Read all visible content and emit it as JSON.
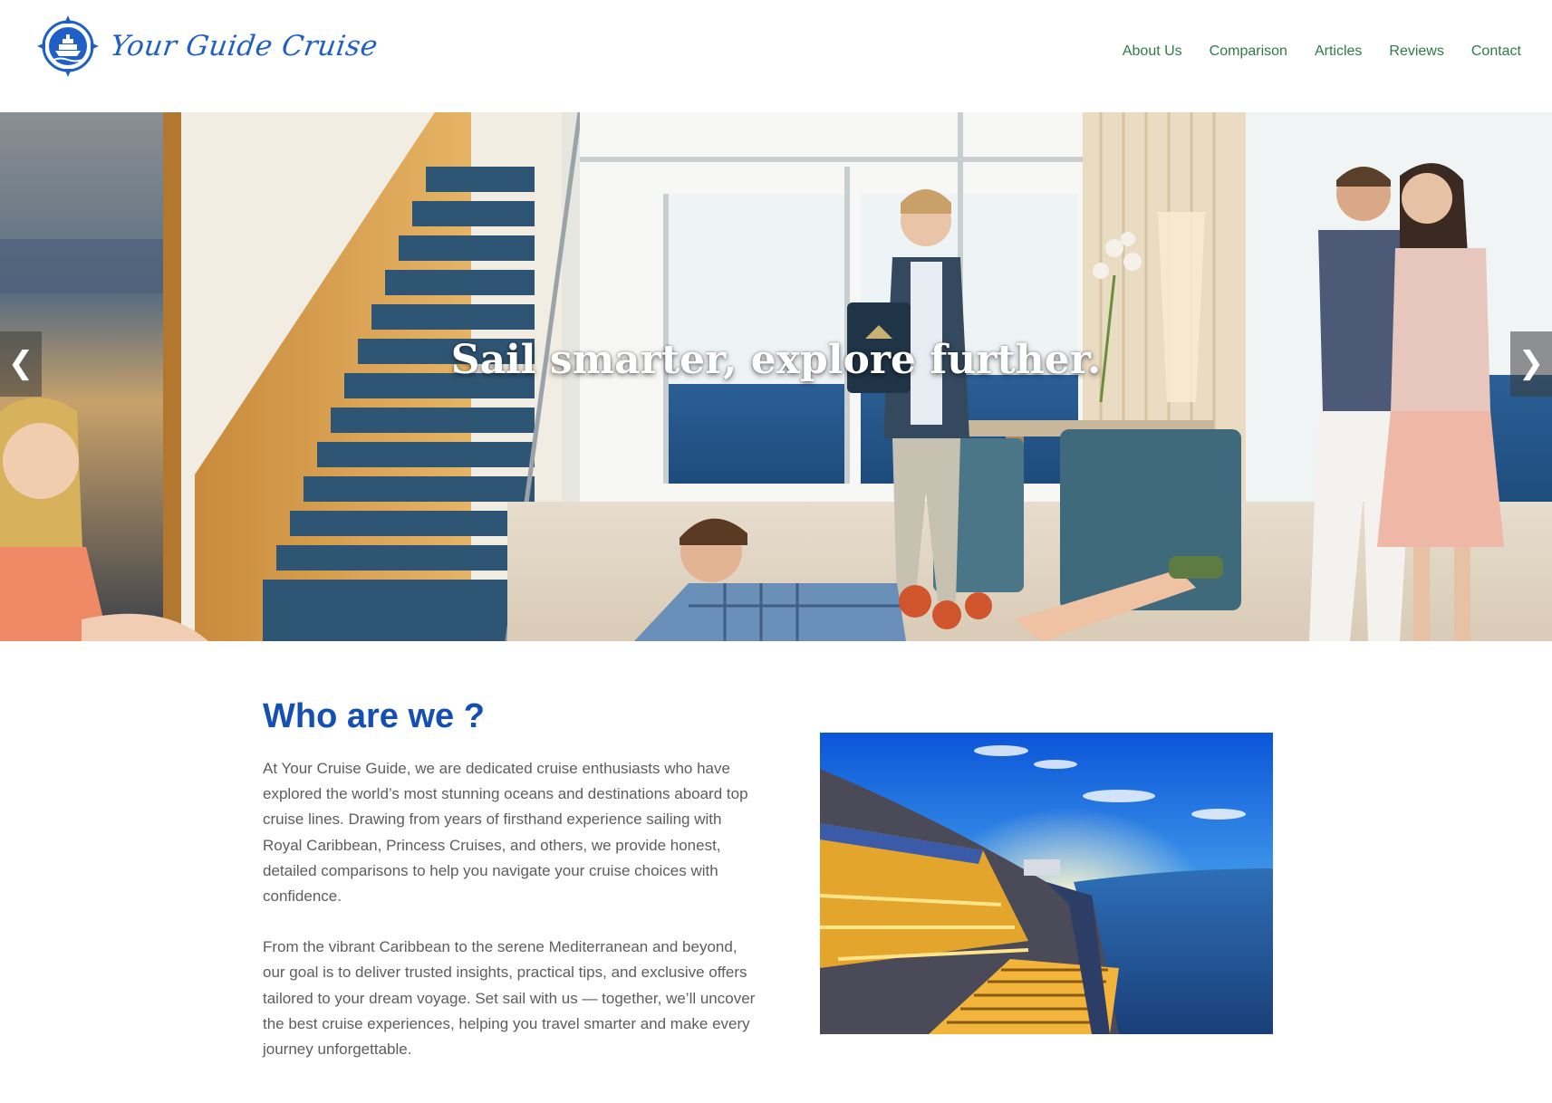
{
  "header": {
    "logo_text": "Your Guide Cruise",
    "logo_icon": "compass-ship-icon",
    "nav": [
      {
        "label": "About Us"
      },
      {
        "label": "Comparison"
      },
      {
        "label": "Articles"
      },
      {
        "label": "Reviews"
      },
      {
        "label": "Contact"
      }
    ]
  },
  "hero": {
    "caption": "Sail smarter, explore further.",
    "prev_arrow": "❮",
    "next_arrow": "❯"
  },
  "about": {
    "title": "Who are we ?",
    "paragraphs": [
      "At Your Cruise Guide, we are dedicated cruise enthusiasts who have explored the world’s most stunning oceans and destinations aboard top cruise lines. Drawing from years of firsthand experience sailing with Royal Caribbean, Princess Cruises, and others, we provide honest, detailed comparisons to help you navigate your cruise choices with confidence.",
      "From the vibrant Caribbean to the serene Mediterranean and beyond, our goal is to deliver trusted insights, practical tips, and exclusive offers tailored to your dream voyage. Set sail with us — together, we’ll uncover the best cruise experiences, helping you travel smarter and make every journey unforgettable."
    ]
  },
  "colors": {
    "brand_blue": "#1f5fc6",
    "heading_blue": "#1450b4",
    "nav_green": "#2d7b49",
    "body_text": "#5d5d5d"
  }
}
